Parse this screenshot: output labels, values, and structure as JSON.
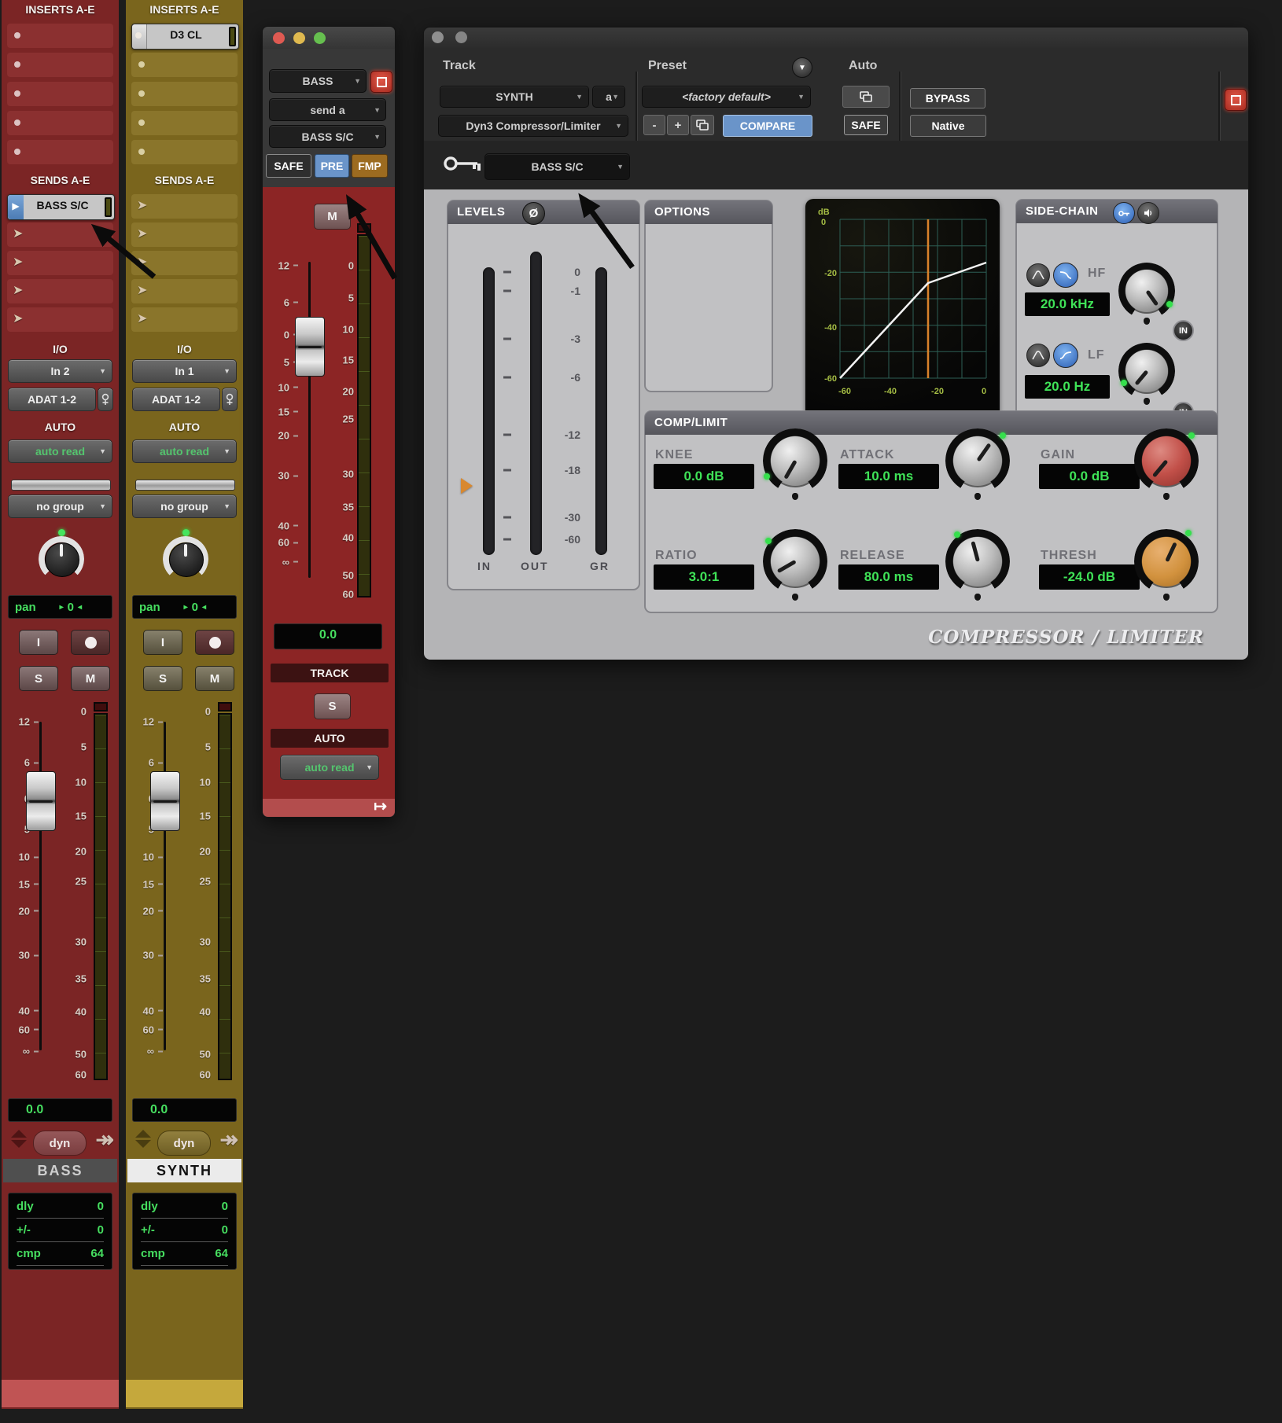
{
  "colors": {
    "bass_strip": "#7b2525",
    "synth_strip": "#7a651d",
    "bass_accent": "#c05454",
    "synth_accent": "#c5a83c",
    "value_green": "#3fe257",
    "pre_active_blue": "#6a94c9",
    "fmp_brown": "#9c6b20",
    "compare_blue": "#6a94c9",
    "graph_label_green": "#a4bc44",
    "threshold_orange": "#d9822b",
    "gain_knob_red": "#c25049",
    "thresh_knob_orange": "#d2923e"
  },
  "mixer": {
    "buttons": {
      "input_monitor": "I",
      "solo": "S",
      "mute": "M"
    },
    "fader_scale": [
      "12",
      "6",
      "0",
      "5",
      "10",
      "15",
      "20",
      "30",
      "40",
      "60",
      "∞"
    ],
    "meter_scale": [
      "0",
      "5",
      "10",
      "15",
      "20",
      "25",
      "30",
      "35",
      "40",
      "50",
      "60"
    ],
    "strips": [
      {
        "name_plate": "BASS",
        "inserts_label": "INSERTS A-E",
        "sends_label": "SENDS A-E",
        "send_a_label": "BASS S/C",
        "io_label": "I/O",
        "input": "In 2",
        "output": "ADAT 1-2",
        "auto_label": "AUTO",
        "auto_mode": "auto read",
        "group": "no group",
        "pan_label": "pan",
        "pan_value": "0",
        "volume": "0.0",
        "dyn": "dyn",
        "dly_label": "dly",
        "dly": "0",
        "trim_label": "+/-",
        "trim": "0",
        "cmp_label": "cmp",
        "cmp": "64"
      },
      {
        "name_plate": "SYNTH",
        "inserts_label": "INSERTS A-E",
        "sends_label": "SENDS A-E",
        "insert_a_label": "D3 CL",
        "io_label": "I/O",
        "input": "In 1",
        "output": "ADAT 1-2",
        "auto_label": "AUTO",
        "auto_mode": "auto read",
        "group": "no group",
        "pan_label": "pan",
        "pan_value": "0",
        "volume": "0.0",
        "dyn": "dyn",
        "dly_label": "dly",
        "dly": "0",
        "trim_label": "+/-",
        "trim": "0",
        "cmp_label": "cmp",
        "cmp": "64"
      }
    ]
  },
  "send_window": {
    "track": "BASS",
    "send_slot": "send a",
    "destination": "BASS S/C",
    "safe": "SAFE",
    "pre": "PRE",
    "fmp": "FMP",
    "mute": "M",
    "volume": "0.0",
    "track_label": "TRACK",
    "solo": "S",
    "auto_label": "AUTO",
    "auto_mode": "auto read",
    "foot_icon": "↦"
  },
  "plugin": {
    "track_label": "Track",
    "track": "SYNTH",
    "playlist": "a",
    "plugin_name": "Dyn3 Compressor/Limiter",
    "preset_label": "Preset",
    "preset": "<factory default>",
    "minus": "-",
    "plus": "+",
    "compare": "COMPARE",
    "auto_label": "Auto",
    "safe": "SAFE",
    "bypass": "BYPASS",
    "native": "Native",
    "key_input": "BASS S/C",
    "levels": {
      "title": "LEVELS",
      "phase": "Ø",
      "scale": [
        "0",
        "-1",
        "-3",
        "-6",
        "-12",
        "-18",
        "-30",
        "-60"
      ],
      "meters": [
        "IN",
        "OUT",
        "GR"
      ]
    },
    "options": {
      "title": "OPTIONS"
    },
    "graph": {
      "db_label": "dB",
      "zero": "0",
      "y_labels": [
        "-20",
        "-40",
        "-60"
      ],
      "x_labels": [
        "-60",
        "-40",
        "-20",
        "0"
      ],
      "threshold_db": -24,
      "curve_points_db": [
        [
          -60,
          -60
        ],
        [
          -24,
          -24
        ],
        [
          0,
          -16
        ]
      ]
    },
    "sidechain": {
      "title": "SIDE-CHAIN",
      "hf_label": "HF",
      "hf_value": "20.0 kHz",
      "lf_label": "LF",
      "lf_value": "20.0 Hz",
      "in_label": "IN"
    },
    "complimit": {
      "title": "COMP/LIMIT",
      "params": [
        {
          "label": "KNEE",
          "value": "0.0 dB",
          "knob": "gray"
        },
        {
          "label": "ATTACK",
          "value": "10.0 ms",
          "knob": "gray"
        },
        {
          "label": "GAIN",
          "value": "0.0 dB",
          "knob": "red"
        },
        {
          "label": "RATIO",
          "value": "3.0:1",
          "knob": "gray"
        },
        {
          "label": "RELEASE",
          "value": "80.0 ms",
          "knob": "gray"
        },
        {
          "label": "THRESH",
          "value": "-24.0 dB",
          "knob": "orange"
        }
      ]
    },
    "logo": "COMPRESSOR / LIMITER"
  }
}
